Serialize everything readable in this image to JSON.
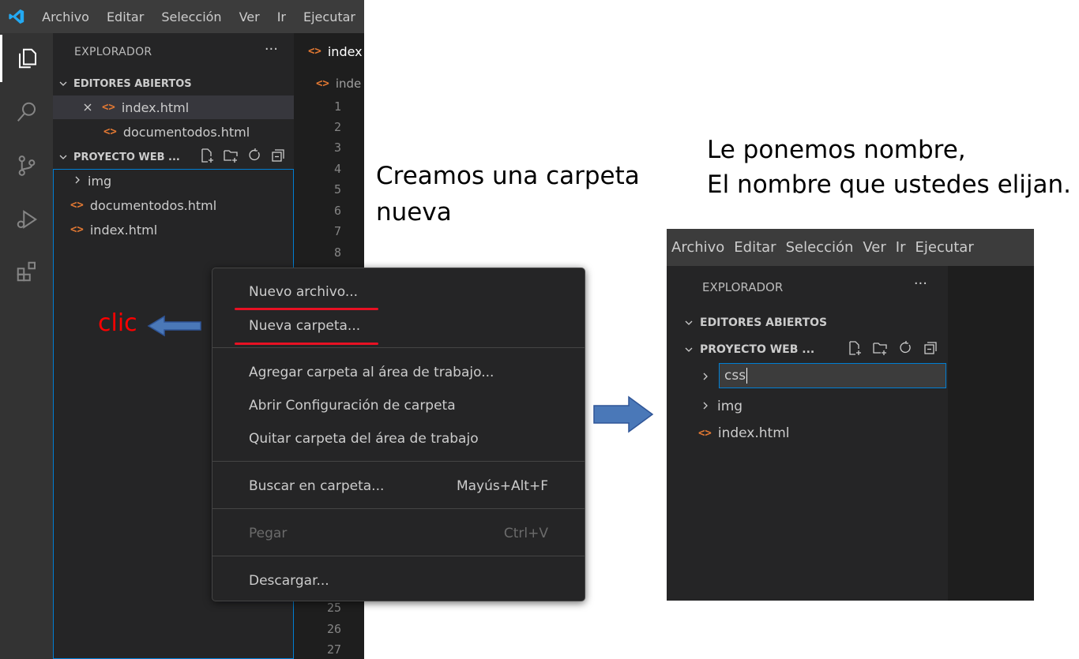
{
  "menubar": {
    "items": [
      "Archivo",
      "Editar",
      "Selección",
      "Ver",
      "Ir",
      "Ejecutar"
    ]
  },
  "explorer": {
    "title": "EXPLORADOR",
    "more": "···",
    "open_editors": {
      "header": "EDITORES ABIERTOS",
      "files": [
        "index.html",
        "documentodos.html"
      ]
    },
    "project": {
      "header": "PROYECTO WEB ...",
      "items": [
        {
          "type": "folder",
          "name": "img"
        },
        {
          "type": "file",
          "name": "documentodos.html"
        },
        {
          "type": "file",
          "name": "index.html"
        }
      ]
    }
  },
  "editor": {
    "tab": "index",
    "breadcrumb": "inde",
    "line_numbers_top": [
      "1",
      "2",
      "3",
      "4",
      "5",
      "6",
      "7",
      "8"
    ],
    "line_numbers_bottom": [
      "25",
      "26",
      "27"
    ]
  },
  "context_menu": {
    "groups": [
      [
        {
          "label": "Nuevo archivo...",
          "shortcut": ""
        },
        {
          "label": "Nueva carpeta...",
          "shortcut": ""
        }
      ],
      [
        {
          "label": "Agregar carpeta al área de trabajo...",
          "shortcut": ""
        },
        {
          "label": "Abrir Configuración de carpeta",
          "shortcut": ""
        },
        {
          "label": "Quitar carpeta del área de trabajo",
          "shortcut": ""
        }
      ],
      [
        {
          "label": "Buscar en carpeta...",
          "shortcut": "Mayús+Alt+F"
        }
      ],
      [
        {
          "label": "Pegar",
          "shortcut": "Ctrl+V"
        }
      ],
      [
        {
          "label": "Descargar...",
          "shortcut": ""
        }
      ]
    ]
  },
  "annotations": {
    "clic": "clic",
    "step1_line1": "Creamos una carpeta",
    "step1_line2": "nueva",
    "step2_line1": "Le ponemos  nombre,",
    "step2_line2": "El nombre que ustedes elijan."
  },
  "right_window": {
    "menubar": [
      "Archivo",
      "Editar",
      "Selección",
      "Ver",
      "Ir",
      "Ejecutar"
    ],
    "explorer_title": "EXPLORADOR",
    "more": "···",
    "open_editors_header": "EDITORES ABIERTOS",
    "project_header": "PROYECTO WEB ...",
    "rename_value": "css",
    "items": [
      {
        "type": "folder",
        "name": "img"
      },
      {
        "type": "file",
        "name": "index.html"
      }
    ]
  },
  "colors": {
    "accent": "#007fd4",
    "html_icon": "#e37933",
    "underline": "#e81123",
    "clic": "#ff0000",
    "arrow": "#4a78b8"
  }
}
